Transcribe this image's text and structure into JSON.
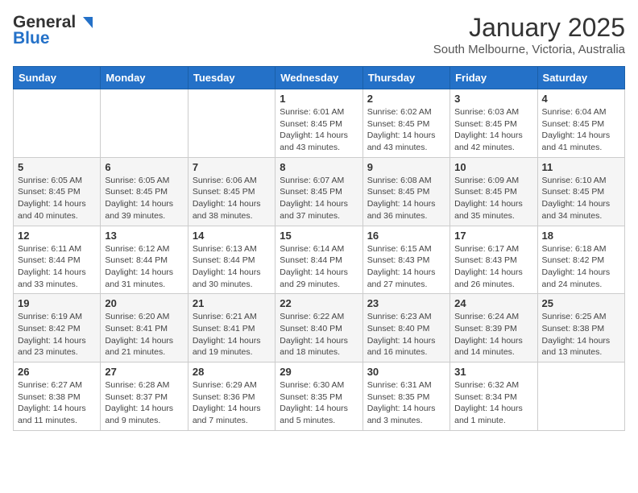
{
  "logo": {
    "general": "General",
    "blue": "Blue"
  },
  "title": "January 2025",
  "subtitle": "South Melbourne, Victoria, Australia",
  "days_of_week": [
    "Sunday",
    "Monday",
    "Tuesday",
    "Wednesday",
    "Thursday",
    "Friday",
    "Saturday"
  ],
  "weeks": [
    [
      {
        "day": "",
        "info": ""
      },
      {
        "day": "",
        "info": ""
      },
      {
        "day": "",
        "info": ""
      },
      {
        "day": "1",
        "info": "Sunrise: 6:01 AM\nSunset: 8:45 PM\nDaylight: 14 hours\nand 43 minutes."
      },
      {
        "day": "2",
        "info": "Sunrise: 6:02 AM\nSunset: 8:45 PM\nDaylight: 14 hours\nand 43 minutes."
      },
      {
        "day": "3",
        "info": "Sunrise: 6:03 AM\nSunset: 8:45 PM\nDaylight: 14 hours\nand 42 minutes."
      },
      {
        "day": "4",
        "info": "Sunrise: 6:04 AM\nSunset: 8:45 PM\nDaylight: 14 hours\nand 41 minutes."
      }
    ],
    [
      {
        "day": "5",
        "info": "Sunrise: 6:05 AM\nSunset: 8:45 PM\nDaylight: 14 hours\nand 40 minutes."
      },
      {
        "day": "6",
        "info": "Sunrise: 6:05 AM\nSunset: 8:45 PM\nDaylight: 14 hours\nand 39 minutes."
      },
      {
        "day": "7",
        "info": "Sunrise: 6:06 AM\nSunset: 8:45 PM\nDaylight: 14 hours\nand 38 minutes."
      },
      {
        "day": "8",
        "info": "Sunrise: 6:07 AM\nSunset: 8:45 PM\nDaylight: 14 hours\nand 37 minutes."
      },
      {
        "day": "9",
        "info": "Sunrise: 6:08 AM\nSunset: 8:45 PM\nDaylight: 14 hours\nand 36 minutes."
      },
      {
        "day": "10",
        "info": "Sunrise: 6:09 AM\nSunset: 8:45 PM\nDaylight: 14 hours\nand 35 minutes."
      },
      {
        "day": "11",
        "info": "Sunrise: 6:10 AM\nSunset: 8:45 PM\nDaylight: 14 hours\nand 34 minutes."
      }
    ],
    [
      {
        "day": "12",
        "info": "Sunrise: 6:11 AM\nSunset: 8:44 PM\nDaylight: 14 hours\nand 33 minutes."
      },
      {
        "day": "13",
        "info": "Sunrise: 6:12 AM\nSunset: 8:44 PM\nDaylight: 14 hours\nand 31 minutes."
      },
      {
        "day": "14",
        "info": "Sunrise: 6:13 AM\nSunset: 8:44 PM\nDaylight: 14 hours\nand 30 minutes."
      },
      {
        "day": "15",
        "info": "Sunrise: 6:14 AM\nSunset: 8:44 PM\nDaylight: 14 hours\nand 29 minutes."
      },
      {
        "day": "16",
        "info": "Sunrise: 6:15 AM\nSunset: 8:43 PM\nDaylight: 14 hours\nand 27 minutes."
      },
      {
        "day": "17",
        "info": "Sunrise: 6:17 AM\nSunset: 8:43 PM\nDaylight: 14 hours\nand 26 minutes."
      },
      {
        "day": "18",
        "info": "Sunrise: 6:18 AM\nSunset: 8:42 PM\nDaylight: 14 hours\nand 24 minutes."
      }
    ],
    [
      {
        "day": "19",
        "info": "Sunrise: 6:19 AM\nSunset: 8:42 PM\nDaylight: 14 hours\nand 23 minutes."
      },
      {
        "day": "20",
        "info": "Sunrise: 6:20 AM\nSunset: 8:41 PM\nDaylight: 14 hours\nand 21 minutes."
      },
      {
        "day": "21",
        "info": "Sunrise: 6:21 AM\nSunset: 8:41 PM\nDaylight: 14 hours\nand 19 minutes."
      },
      {
        "day": "22",
        "info": "Sunrise: 6:22 AM\nSunset: 8:40 PM\nDaylight: 14 hours\nand 18 minutes."
      },
      {
        "day": "23",
        "info": "Sunrise: 6:23 AM\nSunset: 8:40 PM\nDaylight: 14 hours\nand 16 minutes."
      },
      {
        "day": "24",
        "info": "Sunrise: 6:24 AM\nSunset: 8:39 PM\nDaylight: 14 hours\nand 14 minutes."
      },
      {
        "day": "25",
        "info": "Sunrise: 6:25 AM\nSunset: 8:38 PM\nDaylight: 14 hours\nand 13 minutes."
      }
    ],
    [
      {
        "day": "26",
        "info": "Sunrise: 6:27 AM\nSunset: 8:38 PM\nDaylight: 14 hours\nand 11 minutes."
      },
      {
        "day": "27",
        "info": "Sunrise: 6:28 AM\nSunset: 8:37 PM\nDaylight: 14 hours\nand 9 minutes."
      },
      {
        "day": "28",
        "info": "Sunrise: 6:29 AM\nSunset: 8:36 PM\nDaylight: 14 hours\nand 7 minutes."
      },
      {
        "day": "29",
        "info": "Sunrise: 6:30 AM\nSunset: 8:35 PM\nDaylight: 14 hours\nand 5 minutes."
      },
      {
        "day": "30",
        "info": "Sunrise: 6:31 AM\nSunset: 8:35 PM\nDaylight: 14 hours\nand 3 minutes."
      },
      {
        "day": "31",
        "info": "Sunrise: 6:32 AM\nSunset: 8:34 PM\nDaylight: 14 hours\nand 1 minute."
      },
      {
        "day": "",
        "info": ""
      }
    ]
  ]
}
